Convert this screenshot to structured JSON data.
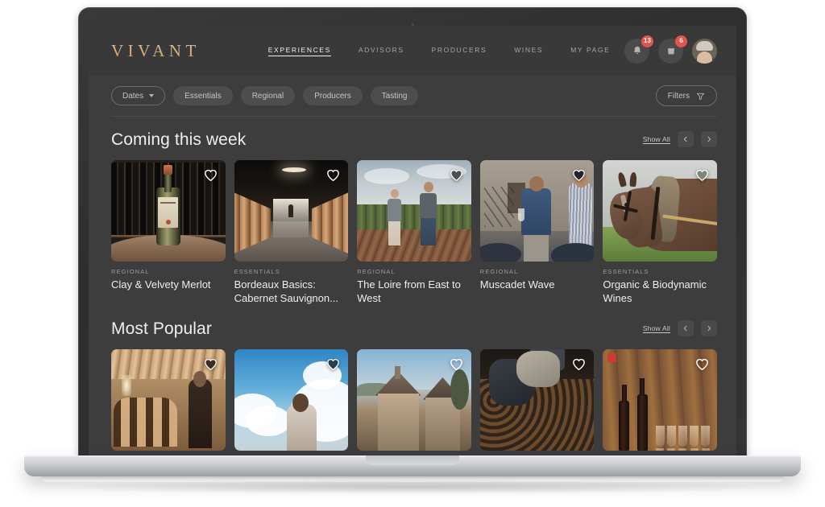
{
  "brand": {
    "logo": "VIVANT"
  },
  "nav": {
    "items": [
      {
        "label": "EXPERIENCES",
        "active": true
      },
      {
        "label": "ADVISORS",
        "active": false
      },
      {
        "label": "PRODUCERS",
        "active": false
      },
      {
        "label": "WINES",
        "active": false
      },
      {
        "label": "MY PAGE",
        "active": false
      }
    ]
  },
  "topright": {
    "notifications": {
      "icon": "bell-icon",
      "badge": "13"
    },
    "cart": {
      "icon": "shopping-bag-icon",
      "badge": "6"
    },
    "avatar": {
      "icon": "avatar"
    }
  },
  "filterbar": {
    "chips": [
      {
        "label": "Dates",
        "style": "outline",
        "chevron": true
      },
      {
        "label": "Essentials",
        "style": "solid",
        "chevron": false
      },
      {
        "label": "Regional",
        "style": "solid",
        "chevron": false
      },
      {
        "label": "Producers",
        "style": "solid",
        "chevron": false
      },
      {
        "label": "Tasting",
        "style": "solid",
        "chevron": false
      }
    ],
    "filters_label": "Filters",
    "filters_icon": "filter-icon"
  },
  "sections": [
    {
      "title": "Coming this week",
      "show_all": "Show All",
      "prev_icon": "chevron-left-icon",
      "next_icon": "chevron-right-icon",
      "cards": [
        {
          "category": "REGIONAL",
          "title": "Clay & Velvety Merlot",
          "scene": "cellar",
          "favorited": false
        },
        {
          "category": "ESSENTIALS",
          "title": "Bordeaux Basics: Cabernet Sauvignon...",
          "scene": "barrels",
          "favorited": false
        },
        {
          "category": "REGIONAL",
          "title": "The Loire from East to West",
          "scene": "vineyard",
          "favorited": true
        },
        {
          "category": "REGIONAL",
          "title": "Muscadet Wave",
          "scene": "tasting",
          "favorited": true
        },
        {
          "category": "ESSENTIALS",
          "title": "Organic & Biodynamic Wines",
          "scene": "horse",
          "favorited": true
        }
      ]
    },
    {
      "title": "Most Popular",
      "show_all": "Show All",
      "prev_icon": "chevron-left-icon",
      "next_icon": "chevron-right-icon",
      "cards": [
        {
          "category": "",
          "title": "",
          "scene": "warmroom",
          "favorited": true
        },
        {
          "category": "",
          "title": "",
          "scene": "sky",
          "favorited": true
        },
        {
          "category": "",
          "title": "",
          "scene": "chateau",
          "favorited": false
        },
        {
          "category": "",
          "title": "",
          "scene": "harvest",
          "favorited": false
        },
        {
          "category": "",
          "title": "",
          "scene": "bottles",
          "favorited": false
        }
      ]
    }
  ],
  "colors": {
    "app_background": "#3d3d3d",
    "topbar_background": "#393939",
    "logo_gold": "#d9ab7e",
    "badge_red": "#e2564a",
    "text_primary": "#f0eeec",
    "text_muted": "#a7a5a2"
  }
}
